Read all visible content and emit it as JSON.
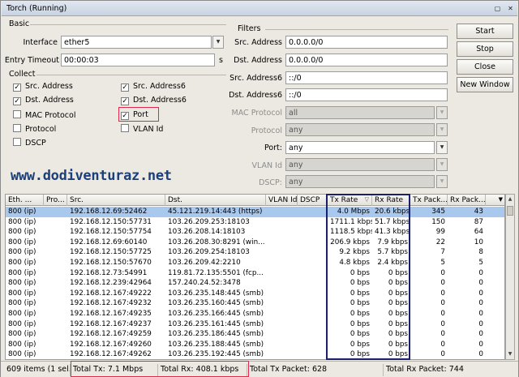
{
  "window": {
    "title": "Torch (Running)"
  },
  "watermark": "www.dodiventuraz.net",
  "basic": {
    "title": "Basic",
    "interface_label": "Interface",
    "interface_value": "ether5",
    "entry_timeout_label": "Entry Timeout",
    "entry_timeout_value": "00:00:03",
    "entry_timeout_unit": "s"
  },
  "collect": {
    "title": "Collect",
    "items": [
      {
        "label": "Src. Address",
        "checked": true
      },
      {
        "label": "Src. Address6",
        "checked": true
      },
      {
        "label": "Dst. Address",
        "checked": true
      },
      {
        "label": "Dst. Address6",
        "checked": true
      },
      {
        "label": "MAC Protocol",
        "checked": false
      },
      {
        "label": "Port",
        "checked": true
      },
      {
        "label": "Protocol",
        "checked": false
      },
      {
        "label": "VLAN Id",
        "checked": false
      },
      {
        "label": "DSCP",
        "checked": false
      }
    ]
  },
  "filters": {
    "title": "Filters",
    "src_address_label": "Src. Address",
    "src_address_value": "0.0.0.0/0",
    "dst_address_label": "Dst. Address",
    "dst_address_value": "0.0.0.0/0",
    "src_address6_label": "Src. Address6",
    "src_address6_value": "::/0",
    "dst_address6_label": "Dst. Address6",
    "dst_address6_value": "::/0",
    "mac_protocol_label": "MAC Protocol",
    "mac_protocol_value": "all",
    "protocol_label": "Protocol",
    "protocol_value": "any",
    "port_label": "Port:",
    "port_value": "any",
    "vlan_id_label": "VLAN Id",
    "vlan_id_value": "any",
    "dscp_label": "DSCP:",
    "dscp_value": "any"
  },
  "buttons": {
    "start": "Start",
    "stop": "Stop",
    "close": "Close",
    "new_window": "New Window"
  },
  "table": {
    "columns": [
      "Eth. ...",
      "Pro...",
      "Src.",
      "Dst.",
      "VLAN Id",
      "DSCP",
      "Tx Rate",
      "Rx Rate",
      "Tx Pack...",
      "Rx Pack..."
    ],
    "rows": [
      [
        "800 (ip)",
        "",
        "192.168.12.69:52462",
        "45.121.219.14:443 (https)",
        "",
        "",
        "4.0 Mbps",
        "20.6 kbps",
        "345",
        "43"
      ],
      [
        "800 (ip)",
        "",
        "192.168.12.150:57731",
        "103.26.209.253:18103",
        "",
        "",
        "1711.1 kbps",
        "51.7 kbps",
        "150",
        "87"
      ],
      [
        "800 (ip)",
        "",
        "192.168.12.150:57754",
        "103.26.208.14:18103",
        "",
        "",
        "1118.5 kbps",
        "41.3 kbps",
        "99",
        "64"
      ],
      [
        "800 (ip)",
        "",
        "192.168.12.69:60140",
        "103.26.208.30:8291 (win...",
        "",
        "",
        "206.9 kbps",
        "7.9 kbps",
        "22",
        "10"
      ],
      [
        "800 (ip)",
        "",
        "192.168.12.150:57725",
        "103.26.209.254:18103",
        "",
        "",
        "9.2 kbps",
        "5.7 kbps",
        "7",
        "8"
      ],
      [
        "800 (ip)",
        "",
        "192.168.12.150:57670",
        "103.26.209.42:2210",
        "",
        "",
        "4.8 kbps",
        "2.4 kbps",
        "5",
        "5"
      ],
      [
        "800 (ip)",
        "",
        "192.168.12.73:54991",
        "119.81.72.135:5501 (fcp...",
        "",
        "",
        "0 bps",
        "0 bps",
        "0",
        "0"
      ],
      [
        "800 (ip)",
        "",
        "192.168.12.239:42964",
        "157.240.24.52:3478",
        "",
        "",
        "0 bps",
        "0 bps",
        "0",
        "0"
      ],
      [
        "800 (ip)",
        "",
        "192.168.12.167:49222",
        "103.26.235.148:445 (smb)",
        "",
        "",
        "0 bps",
        "0 bps",
        "0",
        "0"
      ],
      [
        "800 (ip)",
        "",
        "192.168.12.167:49232",
        "103.26.235.160:445 (smb)",
        "",
        "",
        "0 bps",
        "0 bps",
        "0",
        "0"
      ],
      [
        "800 (ip)",
        "",
        "192.168.12.167:49235",
        "103.26.235.166:445 (smb)",
        "",
        "",
        "0 bps",
        "0 bps",
        "0",
        "0"
      ],
      [
        "800 (ip)",
        "",
        "192.168.12.167:49237",
        "103.26.235.161:445 (smb)",
        "",
        "",
        "0 bps",
        "0 bps",
        "0",
        "0"
      ],
      [
        "800 (ip)",
        "",
        "192.168.12.167:49259",
        "103.26.235.186:445 (smb)",
        "",
        "",
        "0 bps",
        "0 bps",
        "0",
        "0"
      ],
      [
        "800 (ip)",
        "",
        "192.168.12.167:49260",
        "103.26.235.188:445 (smb)",
        "",
        "",
        "0 bps",
        "0 bps",
        "0",
        "0"
      ],
      [
        "800 (ip)",
        "",
        "192.168.12.167:49262",
        "103.26.235.192:445 (smb)",
        "",
        "",
        "0 bps",
        "0 bps",
        "0",
        "0"
      ]
    ]
  },
  "status": {
    "items": "609 items (1 sel...",
    "total_tx": "Total Tx: 7.1 Mbps",
    "total_rx": "Total Rx: 408.1 kbps",
    "total_tx_packet": "Total Tx Packet: 628",
    "total_rx_packet": "Total Rx Packet: 744"
  },
  "colors": {
    "highlight_red": "#e0284b",
    "highlight_blue": "#1a1f6e",
    "selected_row": "#a8c8ee",
    "watermark": "#1b3f7a"
  }
}
